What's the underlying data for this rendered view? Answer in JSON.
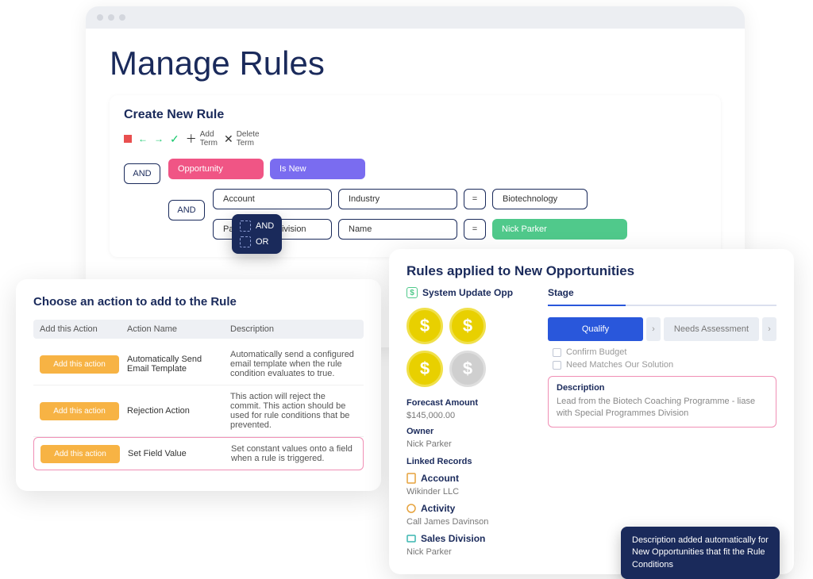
{
  "page": {
    "title": "Manage Rules"
  },
  "create": {
    "title": "Create New Rule",
    "toolbar": {
      "add_term": "Add\nTerm",
      "delete_term": "Delete\nTerm"
    },
    "op1": "AND",
    "op2": "AND",
    "cond1": {
      "entity": "Opportunity",
      "predicate": "Is New"
    },
    "cond2": {
      "a": "Account",
      "b": "Industry",
      "eq": "=",
      "c": "Biotechnology"
    },
    "cond3": {
      "a": "Parent Sales Division",
      "b": "Name",
      "eq": "=",
      "c": "Nick Parker"
    },
    "popover": {
      "and": "AND",
      "or": "OR"
    }
  },
  "actions": {
    "title": "Choose an action to add to the Rule",
    "headers": {
      "add": "Add this Action",
      "name": "Action Name",
      "desc": "Description"
    },
    "add_button": "Add this action",
    "rows": [
      {
        "name": "Automatically Send Email Template",
        "desc": "Automatically send a configured email template when the rule condition evaluates to true."
      },
      {
        "name": "Rejection Action",
        "desc": "This action will reject the commit. This action should be used for rule conditions that be prevented."
      },
      {
        "name": "Set Field Value",
        "desc": "Set constant values onto a field when a rule is triggered."
      }
    ]
  },
  "applied": {
    "title": "Rules applied to New Opportunities",
    "system_update": "System Update Opp",
    "forecast_label": "Forecast Amount",
    "forecast_value": "$145,000.00",
    "owner_label": "Owner",
    "owner_value": "Nick Parker",
    "linked_label": "Linked Records",
    "linked": [
      {
        "title": "Account",
        "value": "Wikinder LLC"
      },
      {
        "title": "Activity",
        "value": "Call James Davinson"
      },
      {
        "title": "Sales Division",
        "value": "Nick Parker"
      }
    ],
    "stage_label": "Stage",
    "steps": {
      "active": "Qualify",
      "next": "Needs Assessment"
    },
    "checks": [
      "Confirm Budget",
      "Need Matches Our Solution"
    ],
    "description_label": "Description",
    "description_value": "Lead from the Biotech Coaching Programme - liase with Special Programmes Division",
    "tooltip": "Description added automatically for New Opportunities that fit the Rule Conditions"
  }
}
